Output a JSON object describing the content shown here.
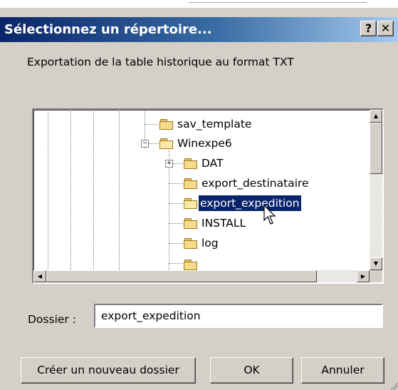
{
  "dialog": {
    "title": "Sélectionnez un répertoire...",
    "help_label": "?",
    "close_label": "✕",
    "description": "Exportation de la table historique au format TXT"
  },
  "tree": {
    "nodes": [
      {
        "label": "sav_template",
        "icon": "folder-icon"
      },
      {
        "label": "Winexpe6",
        "icon": "folder-open-icon",
        "expanded": true
      },
      {
        "label": "DAT",
        "icon": "folder-icon",
        "expandable": true
      },
      {
        "label": "export_destinataire",
        "icon": "folder-icon"
      },
      {
        "label": "export_expedition",
        "icon": "folder-open-icon",
        "selected": true
      },
      {
        "label": "INSTALL",
        "icon": "folder-icon"
      },
      {
        "label": "log",
        "icon": "folder-icon"
      }
    ]
  },
  "folder_field": {
    "label": "Dossier :",
    "value": "export_expedition"
  },
  "buttons": {
    "new_folder": "Créer un nouveau dossier",
    "ok": "OK",
    "cancel": "Annuler"
  },
  "colors": {
    "title_bar": "#0a246a",
    "selection": "#0a246a",
    "face": "#d4d0c8"
  }
}
